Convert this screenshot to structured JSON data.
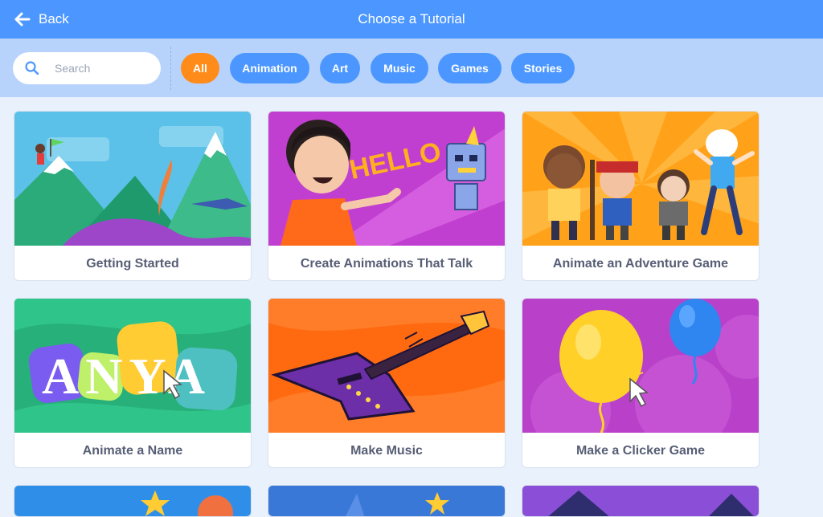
{
  "header": {
    "back_label": "Back",
    "title": "Choose a Tutorial"
  },
  "search": {
    "placeholder": "Search",
    "value": ""
  },
  "filters": [
    {
      "label": "All",
      "active": true
    },
    {
      "label": "Animation",
      "active": false
    },
    {
      "label": "Art",
      "active": false
    },
    {
      "label": "Music",
      "active": false
    },
    {
      "label": "Games",
      "active": false
    },
    {
      "label": "Stories",
      "active": false
    }
  ],
  "tutorials": [
    {
      "title": "Getting Started"
    },
    {
      "title": "Create Animations That Talk",
      "art_text": "HELLO"
    },
    {
      "title": "Animate an Adventure Game"
    },
    {
      "title": "Animate a Name",
      "art_text": "ANYA"
    },
    {
      "title": "Make Music"
    },
    {
      "title": "Make a Clicker Game"
    }
  ],
  "colors": {
    "header": "#4c97ff",
    "filter_bar": "#b7d3fb",
    "active_pill": "#ff8c1a",
    "pill": "#4c97ff",
    "background": "#e9f1fc",
    "card_text": "#575e75"
  },
  "icons": {
    "back": "arrow-left-icon",
    "search": "magnifier-icon"
  }
}
